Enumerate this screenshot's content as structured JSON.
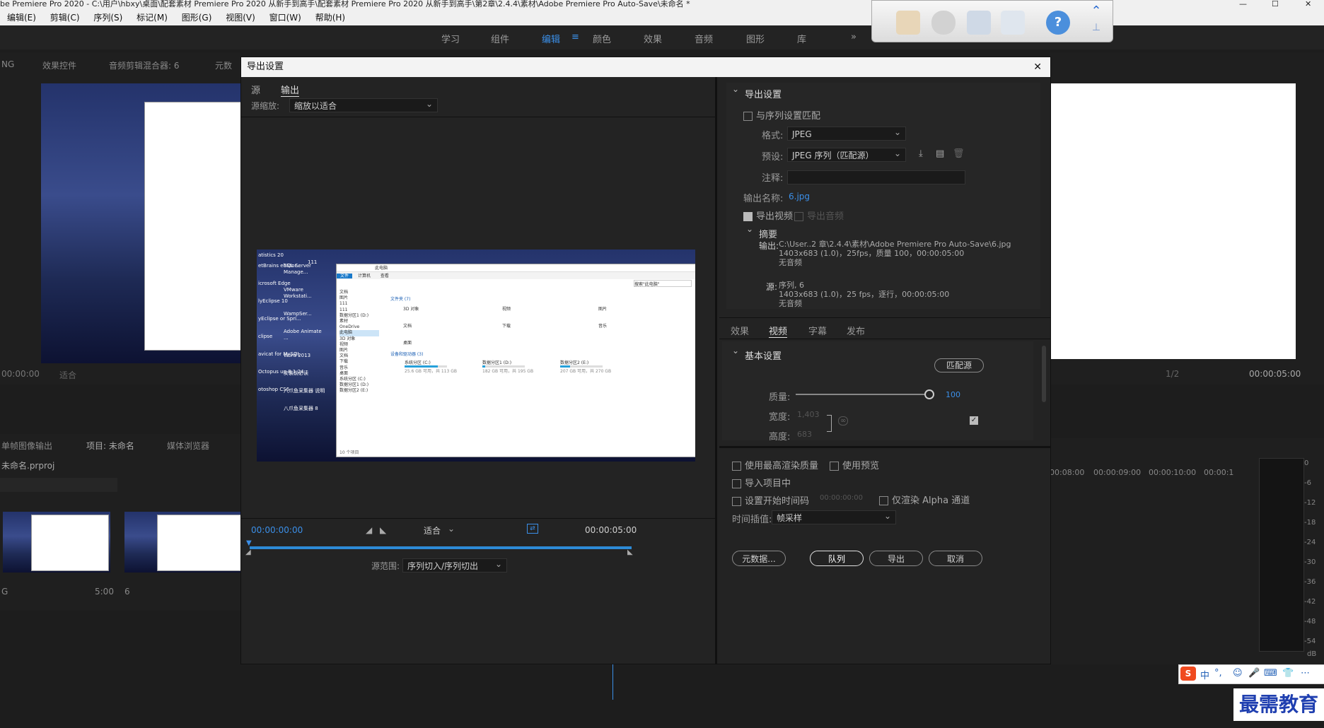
{
  "window_title": "be Premiere Pro 2020 - C:\\用户\\hbxy\\桌面\\配套素材 Premiere Pro 2020 从新手到高手\\配套素材 Premiere Pro 2020 从新手到高手\\第2章\\2.4.4\\素材\\Adobe Premiere Pro Auto-Save\\未命名 *",
  "menu": [
    "编辑(E)",
    "剪辑(C)",
    "序列(S)",
    "标记(M)",
    "图形(G)",
    "视图(V)",
    "窗口(W)",
    "帮助(H)"
  ],
  "workspaces": [
    "学习",
    "组件",
    "编辑",
    "颜色",
    "效果",
    "音频",
    "图形",
    "库"
  ],
  "workspace_more": "»",
  "bg": {
    "left_tabs": [
      "NG",
      "效果控件",
      "音频剪辑混合器: 6",
      "元数"
    ],
    "left_time": "00:00:00",
    "left_fit": "适合",
    "project_tabs": [
      "单帧图像输出",
      "项目: 未命名",
      "媒体浏览器"
    ],
    "project_file": "未命名.prproj",
    "thumb1_label": "G",
    "thumb1_time": "5:00",
    "thumb2_label": "6",
    "right_time": "00:00:05:00",
    "right_zoom": "1/2",
    "timecodes": [
      "00:08:00",
      "00:00:09:00",
      "00:00:10:00",
      "00:00:1"
    ],
    "meter_scale": [
      "0",
      "-6",
      "-12",
      "-18",
      "-24",
      "-30",
      "-36",
      "-42",
      "-48",
      "-54"
    ],
    "meter_db": "dB"
  },
  "dialog": {
    "title": "导出设置",
    "close": "✕",
    "tabs": [
      "源",
      "输出"
    ],
    "source_scale_label": "源缩放:",
    "source_scale_value": "缩放以适合",
    "timeline_start": "00:00:00:00",
    "timeline_end": "00:00:05:00",
    "fit_value": "适合",
    "source_range_label": "源范围:",
    "source_range_value": "序列切入/序列切出",
    "export_settings": {
      "header": "导出设置",
      "match_sequence": "与序列设置匹配",
      "format_label": "格式:",
      "format_value": "JPEG",
      "preset_label": "预设:",
      "preset_value": "JPEG 序列（匹配源）",
      "comment_label": "注释:",
      "output_name_label": "输出名称:",
      "output_name_value": "6.jpg",
      "export_video": "导出视频",
      "export_audio": "导出音频",
      "summary_header": "摘要",
      "output_label": "输出:",
      "output_line1": "C:\\User..2 章\\2.4.4\\素材\\Adobe Premiere Pro Auto-Save\\6.jpg",
      "output_line2": "1403x683 (1.0)，25fps，质量 100，00:00:05:00",
      "output_line3": "无音频",
      "source_label": "源:",
      "source_line1": "序列, 6",
      "source_line2": "1403x683 (1.0)，25 fps，逐行，00:00:05:00",
      "source_line3": "无音频"
    },
    "settings_tabs": [
      "效果",
      "视频",
      "字幕",
      "发布"
    ],
    "basic": {
      "header": "基本设置",
      "match_source": "匹配源",
      "quality_label": "质量:",
      "quality_value": "100",
      "quality_fraction": 1.0,
      "width_label": "宽度:",
      "width_value": "1,403",
      "height_label": "高度:",
      "height_value": "683"
    },
    "bottom": {
      "max_render": "使用最高渲染质量",
      "use_preview": "使用预览",
      "import_project": "导入项目中",
      "set_start_tc": "设置开始时间码",
      "start_tc_value": "00:00:00:00",
      "alpha_only": "仅渲染 Alpha 通道",
      "interp_label": "时间插值:",
      "interp_value": "帧采样"
    },
    "buttons": {
      "metadata": "元数据...",
      "queue": "队列",
      "export": "导出",
      "cancel": "取消"
    }
  },
  "preview_screenshot": {
    "desktop_icons": [
      "atistics 20",
      "etBrains ebStor...",
      "SQL Server Manage...",
      "111",
      "icrosoft Edge",
      "VMware Workstati...",
      "lyEclipse 10",
      "WampSer...",
      "yEclipse or Spri...",
      "Adobe Animate ...",
      "clipse",
      "Word 2013",
      "avicat for MySQL",
      "安装前必读",
      "Octopus up 8.1.24",
      "八爪鱼采集器 说明",
      "otoshop CS6",
      "八爪鱼采集器 8"
    ],
    "explorer": {
      "title": "此电脑",
      "tabs": [
        "文件",
        "计算机",
        "查看"
      ],
      "search": "搜索\"此电脑\"",
      "nav": [
        "文档",
        "图片",
        "111",
        "111",
        "数据分区1 (D:)",
        "素材",
        "OneDrive",
        "此电脑",
        "3D 对象",
        "视频",
        "图片",
        "文档",
        "下载",
        "音乐",
        "桌面",
        "系统分区 (C:)",
        "数据分区1 (D:)",
        "数据分区2 (E:)"
      ],
      "folders_header": "文件夹 (7)",
      "folders": [
        "3D 对象",
        "视频",
        "图片",
        "文档",
        "下载",
        "音乐",
        "桌面"
      ],
      "devices_header": "设备和驱动器 (3)",
      "drives": [
        {
          "name": "系统分区 (C:)",
          "free": "25.6 GB 可用，共 113 GB"
        },
        {
          "name": "数据分区1 (D:)",
          "free": "182 GB 可用，共 195 GB"
        },
        {
          "name": "数据分区2 (E:)",
          "free": "207 GB 可用，共 270 GB"
        }
      ],
      "status": "10 个项目"
    }
  },
  "ime": {
    "logo": "S",
    "items": [
      "中",
      "°,",
      "☺",
      "🎤",
      "⌨",
      "👕",
      "⋯"
    ]
  },
  "watermark": "最需教育"
}
